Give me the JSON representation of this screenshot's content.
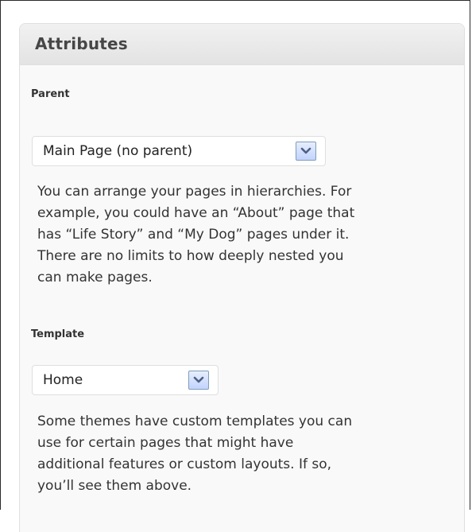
{
  "panel": {
    "title": "Attributes"
  },
  "parent": {
    "label": "Parent",
    "selected": "Main Page (no parent)",
    "dropdown_icon": "chevron-down-icon",
    "help_lines": [
      "You can arrange your pages in hierarchies. For",
      "example, you could have an “About” page that",
      "has “Life Story” and “My Dog” pages under it.",
      "There are no limits to how deeply nested you",
      "can make pages."
    ]
  },
  "template": {
    "label": "Template",
    "selected": "Home",
    "dropdown_icon": "chevron-down-icon",
    "help_lines": [
      "Some themes have custom templates you can",
      "use for certain pages that might have",
      "additional features or custom layouts. If so,",
      "you’ll see them above."
    ]
  },
  "colors": {
    "header_bg": "#e3e3e3",
    "panel_bg": "#f9f9f9",
    "arrow_blue": "#4d6185"
  }
}
